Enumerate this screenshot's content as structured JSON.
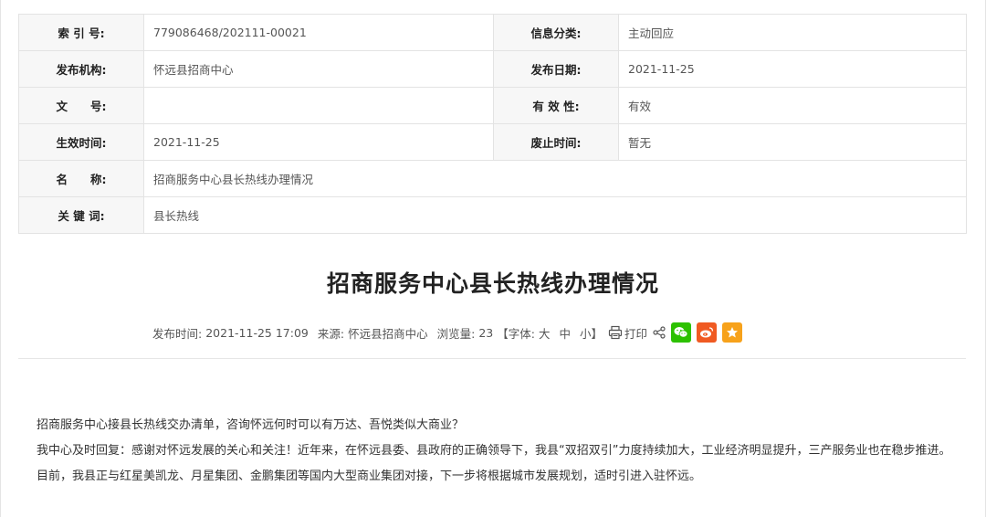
{
  "meta": {
    "index_label": "索 引 号:",
    "index_value": "779086468/202111-00021",
    "category_label": "信息分类:",
    "category_value": "主动回应",
    "publisher_label": "发布机构:",
    "publisher_value": "怀远县招商中心",
    "pubdate_label": "发布日期:",
    "pubdate_value": "2021-11-25",
    "docno_label": "文　　号:",
    "docno_value": "",
    "validity_label": "有 效 性:",
    "validity_value": "有效",
    "effective_label": "生效时间:",
    "effective_value": "2021-11-25",
    "expire_label": "废止时间:",
    "expire_value": "暂无",
    "name_label": "名　　称:",
    "name_value": "招商服务中心县长热线办理情况",
    "keywords_label": "关 键 词:",
    "keywords_value": "县长热线"
  },
  "article": {
    "title": "招商服务中心县长热线办理情况",
    "time_label": "发布时间:",
    "time_value": "2021-11-25 17:09",
    "source_label": "来源:",
    "source_value": "怀远县招商中心",
    "views_label": "浏览量:",
    "views_value": "23",
    "font_open": "【字体:",
    "font_large": "大",
    "font_medium": "中",
    "font_small": "小",
    "font_close": "】",
    "print_label": "打印",
    "paragraphs": [
      "招商服务中心接县长热线交办清单，咨询怀远何时可以有万达、吾悦类似大商业？",
      "我中心及时回复：感谢对怀远发展的关心和关注！近年来，在怀远县委、县政府的正确领导下，我县“双招双引”力度持续加大，工业经济明显提升，三产服务业也在稳步推进。目前，我县正与红星美凯龙、月星集团、金鹏集团等国内大型商业集团对接，下一步将根据城市发展规划，适时引进入驻怀远。"
    ]
  },
  "share": {
    "wechat_color": "#2dc100",
    "weibo_color": "#f05a22",
    "favorite_color": "#f7a21b",
    "icons": [
      "share-icon",
      "wechat-icon",
      "weibo-icon",
      "favorite-icon"
    ]
  }
}
